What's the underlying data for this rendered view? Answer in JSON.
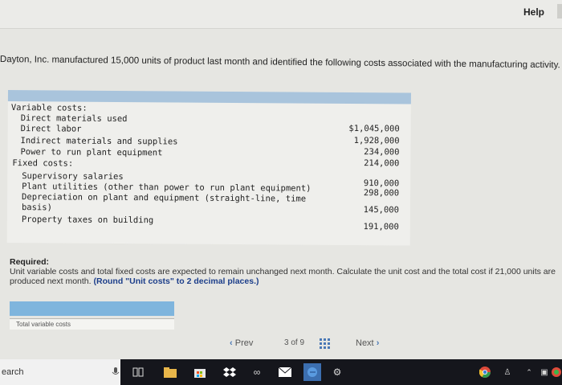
{
  "header": {
    "help_label": "Help"
  },
  "problem": {
    "text": "Dayton, Inc. manufactured 15,000 units of product last month and identified the following costs associated with the manufacturing activity."
  },
  "cost_table": {
    "variable_header": "Variable costs:",
    "variable_items": [
      {
        "label": "Direct materials used",
        "amount": ""
      },
      {
        "label": "Direct labor",
        "amount": "$1,045,000"
      },
      {
        "label": "Indirect materials and supplies",
        "amount": "1,928,000"
      },
      {
        "label": "Power to run plant equipment",
        "amount": "234,000"
      }
    ],
    "variable_last_amount": "214,000",
    "fixed_header": "Fixed costs:",
    "fixed_items": [
      {
        "label": "Supervisory salaries",
        "amount": "910,000"
      },
      {
        "label": "Plant utilities (other than power to run plant equipment)",
        "amount": "298,000"
      },
      {
        "label": "Depreciation on plant and equipment (straight-line, time",
        "amount": ""
      },
      {
        "label": "basis)",
        "amount": "145,000"
      },
      {
        "label": "Property taxes on building",
        "amount": "191,000"
      }
    ]
  },
  "required": {
    "title": "Required:",
    "text": "Unit variable costs and total fixed costs are expected to remain unchanged next month. Calculate the unit cost and the total cost if 21,000 units are produced next month.",
    "round_note": "(Round \"Unit costs\" to 2 decimal places.)"
  },
  "answer": {
    "field_label": "Total variable costs"
  },
  "pager": {
    "prev_label": "Prev",
    "page_current": "3",
    "page_of": "of",
    "page_total": "9",
    "next_label": "Next"
  },
  "taskbar": {
    "search_text": "earch"
  }
}
